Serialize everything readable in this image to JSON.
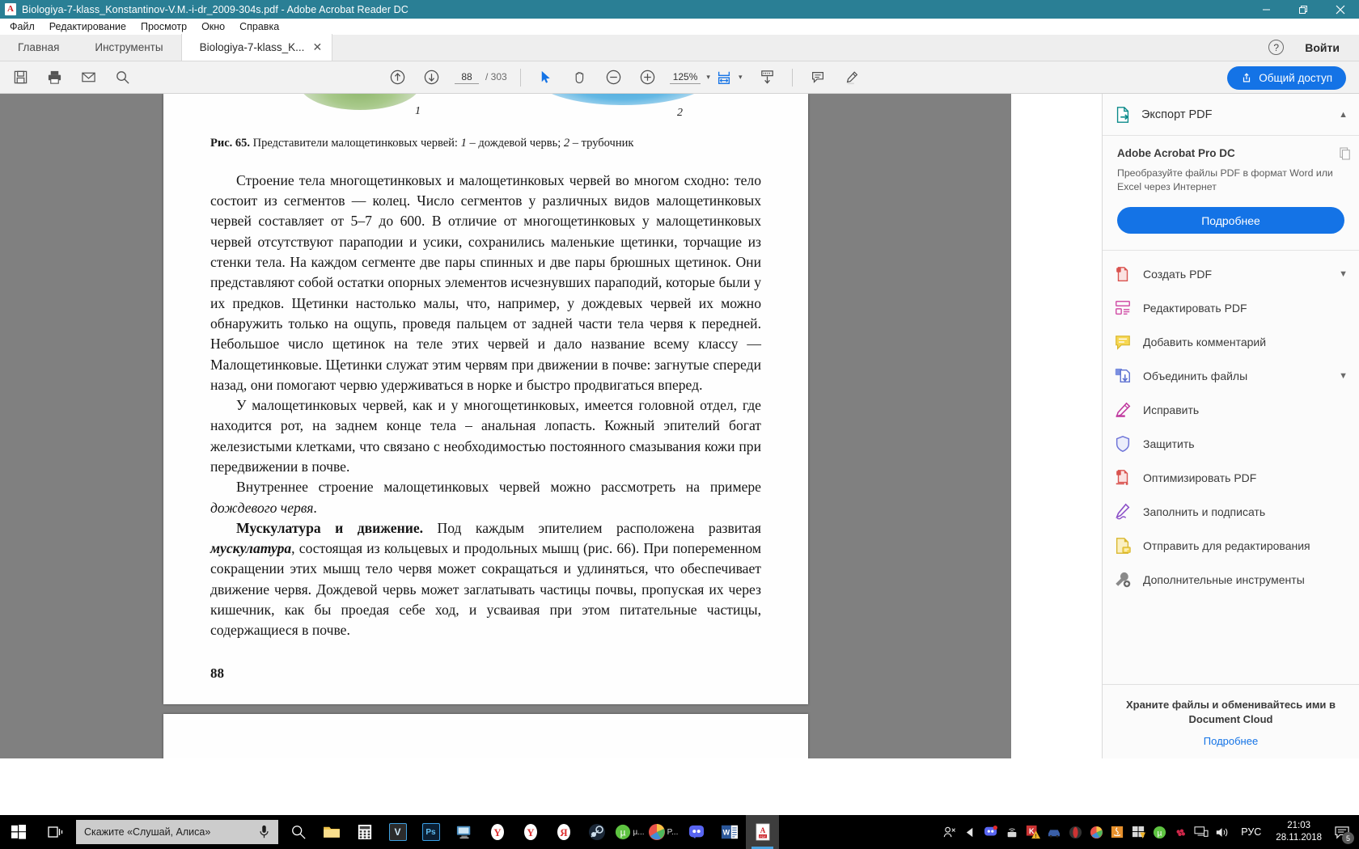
{
  "window": {
    "title": "Biologiya-7-klass_Konstantinov-V.M.-i-dr_2009-304s.pdf - Adobe Acrobat Reader DC",
    "minimize": "—",
    "maximize": "❐",
    "close": "✕"
  },
  "menu": {
    "items": [
      {
        "label": "Файл"
      },
      {
        "label": "Редактирование"
      },
      {
        "label": "Просмотр"
      },
      {
        "label": "Окно"
      },
      {
        "label": "Справка"
      }
    ]
  },
  "tabs": {
    "home": "Главная",
    "tools": "Инструменты",
    "document": "Biologiya-7-klass_K...",
    "close_glyph": "✕",
    "help_glyph": "?",
    "signin": "Войти"
  },
  "toolbar": {
    "page_current": "88",
    "page_total": "/ 303",
    "zoom": "125%",
    "zoom_caret": "▾",
    "fit_caret": "▾",
    "share_label": "Общий доступ",
    "icons": [
      "save-icon",
      "print-icon",
      "email-icon",
      "search-icon",
      "previous-page-icon",
      "next-page-icon",
      "select-tool-icon",
      "hand-tool-icon",
      "zoom-out-icon",
      "zoom-in-icon",
      "fit-page-icon",
      "scroll-mode-icon",
      "comment-icon",
      "highlight-icon"
    ]
  },
  "document": {
    "figure_number": "Рис. 65.",
    "figure_caption_main": " Представители малощетинковых червей: ",
    "figure_caption_i1": "1",
    "figure_caption_t1": " – дождевой червь; ",
    "figure_caption_i2": "2",
    "figure_caption_t2": " – трубочник",
    "label_1": "1",
    "label_2": "2",
    "paragraph_1": "Строение тела многощетинковых и малощетинковых червей во многом сходно: тело состоит из сегментов — колец. Число сегментов у различных видов малощетинковых червей составляет от 5–7 до 600. В отличие от многощетинковых у малощетинковых червей отсутствуют параподии и усики, сохранились маленькие щетинки, торчащие из стенки тела. На каждом сегменте две пары спинных и две пары брюшных щетинок. Они представляют собой остатки опорных элементов исчезнувших параподий, которые были у их предков. Щетинки настолько малы, что, например, у дождевых червей их можно обнаружить только на ощупь, проведя пальцем от задней части тела червя к передней. Небольшое число щетинок на теле этих червей и дало название всему классу — Малощетинковые. Щетинки служат этим червям при движении в почве: загнутые спереди назад, они помогают червю удерживаться в норке и быстро продвигаться вперед.",
    "paragraph_2": "У малощетинковых червей, как и у многощетинковых, имеется головной отдел, где находится рот, на заднем конце тела – анальная лопасть. Кожный эпителий богат железистыми клетками, что связано с необходимостью постоянного смазывания кожи при передвижении в почве.",
    "paragraph_3_a": "Внутреннее строение малощетинковых червей можно рассмотреть на примере ",
    "paragraph_3_i": "дождевого червя",
    "paragraph_3_b": ".",
    "paragraph_4_bold": "Мускулатура и движение.",
    "paragraph_4_a": " Под каждым эпителием расположена развитая ",
    "paragraph_4_bi": "мускулатура",
    "paragraph_4_b": ", состоящая из кольцевых и продольных мышц (рис. 66). При попеременном сокращении этих мышц тело червя может сокращаться и удлиняться, что обеспечивает движение червя. Дождевой червь может заглатывать частицы почвы, пропуская их через кишечник, как бы проедая себе ход, и усваивая при этом питательные частицы, содержащиеся в почве.",
    "page_folio": "88"
  },
  "sidebar": {
    "header_label": "Экспорт PDF",
    "header_chevron": "ⱏ",
    "promo": {
      "title": "Adobe Acrobat Pro DC",
      "description": "Преобразуйте файлы PDF в формат Word или Excel через Интернет",
      "button": "Подробнее"
    },
    "tools": [
      {
        "label": "Создать PDF",
        "icon": "create-pdf-icon",
        "chevron": "ⱟ"
      },
      {
        "label": "Редактировать PDF",
        "icon": "edit-pdf-icon",
        "chevron": ""
      },
      {
        "label": "Добавить комментарий",
        "icon": "add-comment-icon",
        "chevron": ""
      },
      {
        "label": "Объединить файлы",
        "icon": "combine-files-icon",
        "chevron": "ⱟ"
      },
      {
        "label": "Исправить",
        "icon": "correct-icon",
        "chevron": ""
      },
      {
        "label": "Защитить",
        "icon": "protect-shield-icon",
        "chevron": ""
      },
      {
        "label": "Оптимизировать PDF",
        "icon": "optimize-pdf-icon",
        "chevron": ""
      },
      {
        "label": "Заполнить и подписать",
        "icon": "fill-and-sign-icon",
        "chevron": ""
      },
      {
        "label": "Отправить для редактирования",
        "icon": "send-for-review-icon",
        "chevron": ""
      },
      {
        "label": "Дополнительные инструменты",
        "icon": "more-tools-icon",
        "chevron": ""
      }
    ],
    "footer": {
      "title_line1": "Храните файлы и обменивайтесь ими в",
      "title_line2": "Document Cloud",
      "link": "Подробнее"
    }
  },
  "taskbar": {
    "search_placeholder": "Скажите «Слушай, Алиса»",
    "language": "РУС",
    "time": "21:03",
    "date": "28.11.2018",
    "notification_count": "5",
    "apps": [
      {
        "name": "search-icon",
        "glyph": "",
        "label": ""
      },
      {
        "name": "file-explorer-icon",
        "glyph": "",
        "label": ""
      },
      {
        "name": "calculator-icon",
        "glyph": "",
        "label": ""
      },
      {
        "name": "visual-studio-icon",
        "glyph": "V",
        "label": ""
      },
      {
        "name": "photoshop-icon",
        "glyph": "Ps",
        "label": ""
      },
      {
        "name": "remote-desktop-icon",
        "glyph": "",
        "label": ""
      },
      {
        "name": "yandex-browser-icon",
        "glyph": "Y",
        "label": ""
      },
      {
        "name": "yandex-browser-2-icon",
        "glyph": "Y",
        "label": ""
      },
      {
        "name": "yandex-icon",
        "glyph": "Я",
        "label": ""
      },
      {
        "name": "steam-icon",
        "glyph": "",
        "label": ""
      },
      {
        "name": "utorrent-icon",
        "glyph": "µ",
        "label": "µ..."
      },
      {
        "name": "photos-icon",
        "glyph": "",
        "label": "P..."
      },
      {
        "name": "discord-icon",
        "glyph": "",
        "label": ""
      },
      {
        "name": "word-icon",
        "glyph": "W",
        "label": ""
      },
      {
        "name": "acrobat-reader-icon",
        "glyph": "",
        "label": ""
      }
    ]
  }
}
